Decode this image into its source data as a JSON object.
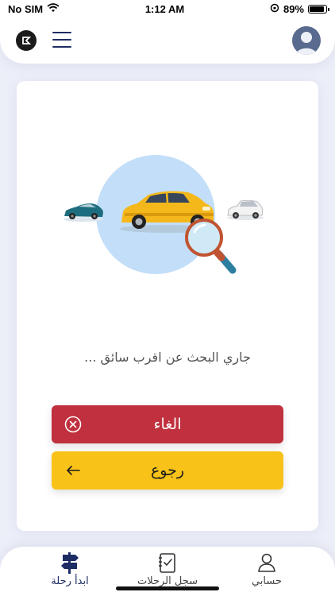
{
  "status_bar": {
    "carrier": "No SIM",
    "time": "1:12 AM",
    "battery_percent": "89%",
    "battery_level": 0.89,
    "icons": [
      "wifi-icon",
      "orientation-lock-icon",
      "battery-icon"
    ]
  },
  "header": {
    "logo_icon": "app-logo-icon",
    "menu_icon": "hamburger-menu-icon",
    "avatar_icon": "user-avatar-icon"
  },
  "search": {
    "status_text": "جاري البحث عن اقرب سائق ...",
    "illustration": "car-search-illustration"
  },
  "actions": {
    "cancel_label": "الغاء",
    "cancel_icon": "close-circle-icon",
    "back_label": "رجوع",
    "back_icon": "arrow-left-icon"
  },
  "bottom_nav": {
    "items": [
      {
        "label": "ابدأ رحلة",
        "icon": "signpost-icon",
        "active": true
      },
      {
        "label": "سجل الرحلات",
        "icon": "clipboard-icon",
        "active": false
      },
      {
        "label": "حسابي",
        "icon": "user-icon",
        "active": false
      }
    ]
  },
  "colors": {
    "cancel": "#c0303e",
    "back": "#f8c218",
    "primary": "#1e2c64",
    "background": "#eceef8"
  }
}
